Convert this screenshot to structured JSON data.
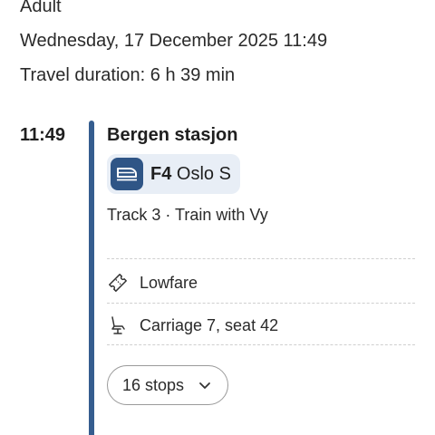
{
  "summary": {
    "passenger": "Adult",
    "date_time": "Wednesday, 17 December 2025 11:49",
    "duration": "Travel duration: 6 h 39 min"
  },
  "leg": {
    "departure_time": "11:49",
    "station": "Bergen stasjon",
    "train": {
      "line": "F4",
      "destination": "Oslo S",
      "icon": "train-icon"
    },
    "track_info": "Track 3 · Train with Vy",
    "fare": {
      "label": "Lowfare",
      "icon": "ticket-icon"
    },
    "seat": {
      "label": "Carriage 7, seat 42",
      "icon": "seat-icon"
    },
    "stops_button": {
      "label": "16 stops",
      "icon": "chevron-down-icon"
    }
  },
  "colors": {
    "route_line": "#355d8f",
    "train_badge": "#2f5586",
    "chip_background": "#e8eef6"
  }
}
